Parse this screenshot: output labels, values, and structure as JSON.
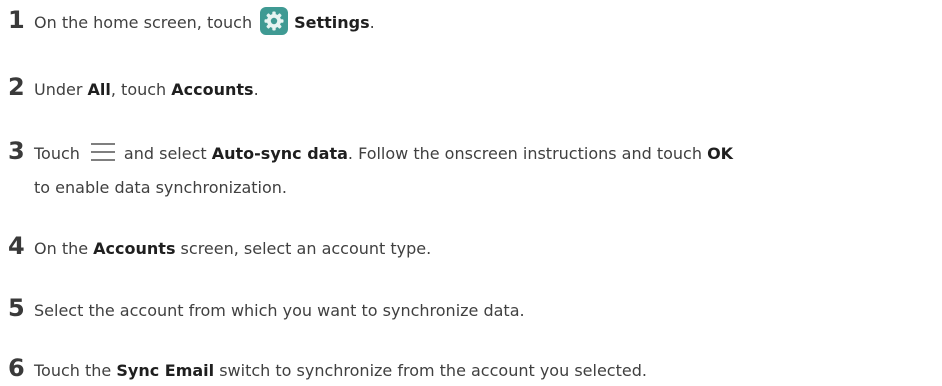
{
  "steps": [
    {
      "number": "1",
      "before": "On the home screen, touch",
      "icon": "settings-gear-icon",
      "icon_color": "#3f9a93",
      "bold1": "Settings",
      "after": "."
    },
    {
      "number": "2",
      "before": "Under ",
      "bold1": "All",
      "mid": ", touch ",
      "bold2": "Accounts",
      "after": "."
    },
    {
      "number": "3",
      "before": "Touch",
      "icon": "menu-lines-icon",
      "mid": "and select ",
      "bold1": "Auto-sync data",
      "mid2": ". Follow the onscreen instructions and touch ",
      "bold2": "OK",
      "continuation": "to enable data synchronization."
    },
    {
      "number": "4",
      "before": "On the ",
      "bold1": "Accounts",
      "after": " screen, select an account type."
    },
    {
      "number": "5",
      "text": "Select the account from which you want to synchronize data."
    },
    {
      "number": "6",
      "before": "Touch the ",
      "bold1": "Sync Email",
      "after": " switch to synchronize from the account you selected."
    }
  ]
}
